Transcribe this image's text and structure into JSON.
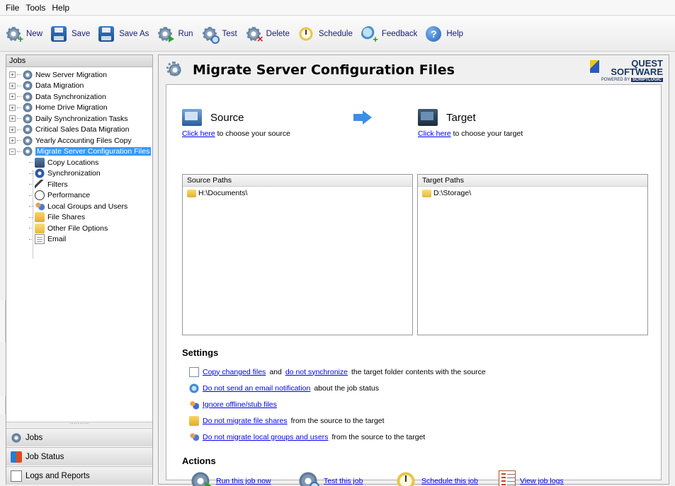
{
  "menu": {
    "items": [
      "File",
      "Tools",
      "Help"
    ]
  },
  "toolbar": {
    "new_label": "New",
    "save_label": "Save",
    "saveas_label": "Save As",
    "run_label": "Run",
    "test_label": "Test",
    "delete_label": "Delete",
    "schedule_label": "Schedule",
    "feedback_label": "Feedback",
    "help_label": "Help"
  },
  "jobs_panel": {
    "title": "Jobs",
    "jobs": [
      "New Server Migration",
      "Data Migration",
      "Data Synchronization",
      "Home Drive Migration",
      "Daily Synchronization Tasks",
      "Critical Sales Data Migration",
      "Yearly Accounting Files Copy",
      "Migrate Server Configuration Files"
    ],
    "children": [
      "Copy Locations",
      "Synchronization",
      "Filters",
      "Performance",
      "Local Groups and Users",
      "File Shares",
      "Other File Options",
      "Email"
    ],
    "splitter_grip": "··········",
    "nav": {
      "jobs": "Jobs",
      "job_status": "Job Status",
      "logs_reports": "Logs and Reports"
    }
  },
  "main": {
    "title": "Migrate Server Configuration Files",
    "brand": {
      "line1": "QUEST",
      "line2": "SOFTWARE",
      "powered": "POWERED BY",
      "powered_brand": "SCRIPTLOGIC"
    },
    "source": {
      "heading": "Source",
      "link": "Click here",
      "link_suffix": "to choose your source",
      "column": "Source Paths",
      "paths": [
        "H:\\Documents\\"
      ]
    },
    "target": {
      "heading": "Target",
      "link": "Click here",
      "link_suffix": "to choose your target",
      "column": "Target Paths",
      "paths": [
        "D:\\Storage\\"
      ]
    },
    "settings": {
      "heading": "Settings",
      "row1": {
        "link1": "Copy changed files",
        "mid": "and",
        "link2": "do not synchronize",
        "rest": "the target folder contents with the source"
      },
      "row2": {
        "link": "Do not send an email notification",
        "rest": "about the job status"
      },
      "row3": {
        "link": "Ignore offline/stub files"
      },
      "row4": {
        "link": "Do not migrate file shares",
        "rest": "from the source to the target"
      },
      "row5": {
        "link": "Do not migrate local groups and users",
        "rest": "from the source to the target"
      }
    },
    "actions": {
      "heading": "Actions",
      "run": "Run this job now",
      "test": "Test this job",
      "schedule": "Schedule this job",
      "logs": "View job logs"
    }
  }
}
